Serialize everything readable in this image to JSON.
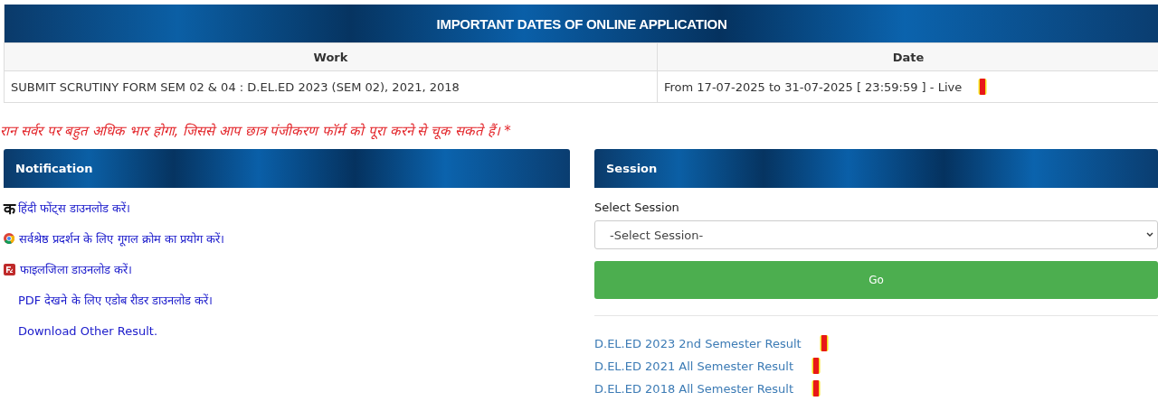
{
  "dates_table": {
    "title": "IMPORTANT DATES OF ONLINE APPLICATION",
    "columns": [
      "Work",
      "Date"
    ],
    "rows": [
      {
        "work": "SUBMIT SCRUTINY FORM SEM 02 & 04 : D.EL.ED 2023 (SEM 02), 2021, 2018",
        "date": "From 17-07-2025 to 31-07-2025 [ 23:59:59 ] - Live",
        "new": true
      }
    ]
  },
  "warning": "रान सर्वर पर बहुत अधिक भार होगा, जिससे आप छात्र पंजीकरण फॉर्म को पूरा करने से चूक सकते हैं। *",
  "notification": {
    "title": "Notification",
    "items": [
      {
        "kind": "letter",
        "glyph": "क",
        "text": "हिंदी फोंट्स डाउनलोड करें।"
      },
      {
        "kind": "chrome",
        "text": "सर्वश्रेष्ठ प्रदर्शन के लिए गूगल क्रोम का प्रयोग करें।"
      },
      {
        "kind": "filezilla",
        "text": "फाइलजिला डाउनलोड करें।"
      },
      {
        "kind": "plain",
        "text": "PDF देखने के लिए एडोब रीडर डाउनलोड करें।"
      },
      {
        "kind": "plain",
        "text": "Download Other Result."
      }
    ]
  },
  "session": {
    "title": "Session",
    "label": "Select Session",
    "select": "-Select Session-",
    "button": "Go",
    "results": [
      {
        "text": "D.EL.ED 2023 2nd Semester Result",
        "new": true
      },
      {
        "text": "D.EL.ED 2021 All Semester Result",
        "new": true
      },
      {
        "text": "D.EL.ED 2018 All Semester Result",
        "new": true
      }
    ]
  }
}
